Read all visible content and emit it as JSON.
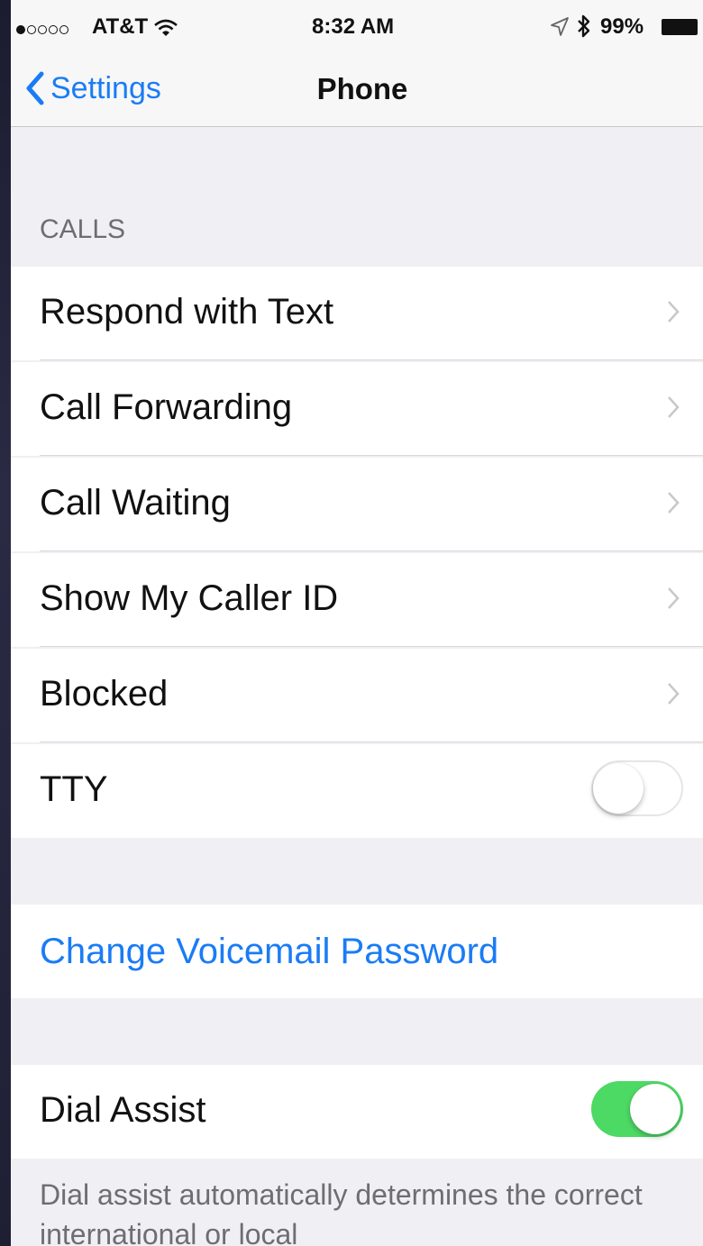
{
  "status_bar": {
    "signal_dots_filled": 1,
    "signal_dots_total": 5,
    "carrier": "AT&T",
    "time": "8:32 AM",
    "battery_percent": "99%",
    "icons": [
      "wifi-icon",
      "location-icon",
      "bluetooth-icon",
      "battery-icon"
    ]
  },
  "nav": {
    "back_label": "Settings",
    "title": "Phone"
  },
  "calls_section": {
    "header": "CALLS",
    "items": [
      {
        "label": "Respond with Text",
        "accessory": "chevron"
      },
      {
        "label": "Call Forwarding",
        "accessory": "chevron"
      },
      {
        "label": "Call Waiting",
        "accessory": "chevron"
      },
      {
        "label": "Show My Caller ID",
        "accessory": "chevron"
      },
      {
        "label": "Blocked",
        "accessory": "chevron"
      },
      {
        "label": "TTY",
        "accessory": "toggle",
        "on": false
      }
    ]
  },
  "voicemail": {
    "label": "Change Voicemail Password"
  },
  "dial_assist": {
    "label": "Dial Assist",
    "on": true,
    "footer": "Dial assist automatically determines the correct international or local"
  },
  "colors": {
    "accent": "#1a7cf5",
    "toggle_on": "#4cd964",
    "grouped_background": "#efeff4"
  }
}
